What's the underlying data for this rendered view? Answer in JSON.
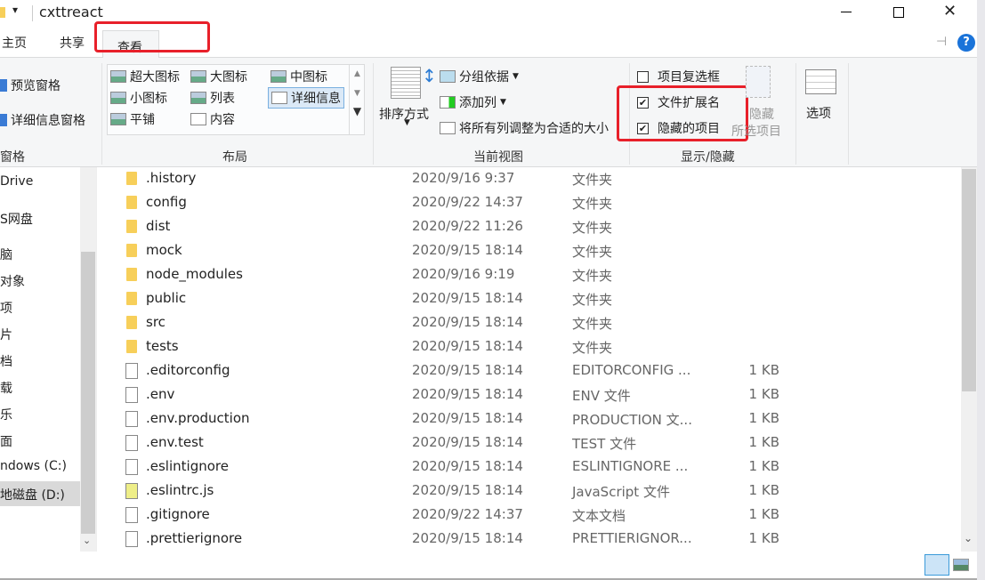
{
  "window": {
    "title": "cxttreact",
    "controls": [
      "minimize",
      "maximize",
      "close"
    ]
  },
  "tabs": [
    {
      "label": "主页"
    },
    {
      "label": "共享"
    },
    {
      "label": "查看",
      "active": true
    }
  ],
  "ribbon": {
    "panes": {
      "preview": "预览窗格",
      "details": "详细信息窗格",
      "group": "窗格"
    },
    "layout": {
      "items": [
        "超大图标",
        "大图标",
        "中图标",
        "小图标",
        "列表",
        "详细信息",
        "平铺",
        "内容"
      ],
      "selected": "详细信息",
      "group": "布局"
    },
    "current_view": {
      "sort": "排序方式",
      "group_by": "分组依据",
      "add_column": "添加列",
      "fit_columns": "将所有列调整为合适的大小",
      "group": "当前视图"
    },
    "show_hide": {
      "item_checkboxes": {
        "label": "项目复选框",
        "checked": false
      },
      "file_extensions": {
        "label": "文件扩展名",
        "checked": true
      },
      "hidden_items": {
        "label": "隐藏的项目",
        "checked": true
      },
      "hide_selected_1": "隐藏",
      "hide_selected_2": "所选项目",
      "group": "显示/隐藏"
    },
    "options": "选项"
  },
  "highlight_color": "#e8202a",
  "nav": [
    "Drive",
    "S网盘",
    "脑",
    "对象",
    "项",
    "片",
    "档",
    "载",
    "乐",
    "面",
    "ndows (C:)",
    "地磁盘 (D:)"
  ],
  "nav_selected": "地磁盘 (D:)",
  "files": [
    {
      "name": ".history",
      "date": "2020/9/16 9:37",
      "type": "文件夹",
      "size": "",
      "icon": "folder"
    },
    {
      "name": "config",
      "date": "2020/9/22 14:37",
      "type": "文件夹",
      "size": "",
      "icon": "folder"
    },
    {
      "name": "dist",
      "date": "2020/9/22 11:26",
      "type": "文件夹",
      "size": "",
      "icon": "folder"
    },
    {
      "name": "mock",
      "date": "2020/9/15 18:14",
      "type": "文件夹",
      "size": "",
      "icon": "folder"
    },
    {
      "name": "node_modules",
      "date": "2020/9/16 9:19",
      "type": "文件夹",
      "size": "",
      "icon": "folder"
    },
    {
      "name": "public",
      "date": "2020/9/15 18:14",
      "type": "文件夹",
      "size": "",
      "icon": "folder"
    },
    {
      "name": "src",
      "date": "2020/9/15 18:14",
      "type": "文件夹",
      "size": "",
      "icon": "folder"
    },
    {
      "name": "tests",
      "date": "2020/9/15 18:14",
      "type": "文件夹",
      "size": "",
      "icon": "folder"
    },
    {
      "name": ".editorconfig",
      "date": "2020/9/15 18:14",
      "type": "EDITORCONFIG ...",
      "size": "1 KB",
      "icon": "file"
    },
    {
      "name": ".env",
      "date": "2020/9/15 18:14",
      "type": "ENV 文件",
      "size": "1 KB",
      "icon": "file"
    },
    {
      "name": ".env.production",
      "date": "2020/9/15 18:14",
      "type": "PRODUCTION 文...",
      "size": "1 KB",
      "icon": "file"
    },
    {
      "name": ".env.test",
      "date": "2020/9/15 18:14",
      "type": "TEST 文件",
      "size": "1 KB",
      "icon": "file"
    },
    {
      "name": ".eslintignore",
      "date": "2020/9/15 18:14",
      "type": "ESLINTIGNORE ...",
      "size": "1 KB",
      "icon": "file"
    },
    {
      "name": ".eslintrc.js",
      "date": "2020/9/15 18:14",
      "type": "JavaScript 文件",
      "size": "1 KB",
      "icon": "js-file"
    },
    {
      "name": ".gitignore",
      "date": "2020/9/22 14:37",
      "type": "文本文档",
      "size": "1 KB",
      "icon": "text-file"
    },
    {
      "name": ".prettierignore",
      "date": "2020/9/15 18:14",
      "type": "PRETTIERIGNOR...",
      "size": "1 KB",
      "icon": "file"
    }
  ]
}
